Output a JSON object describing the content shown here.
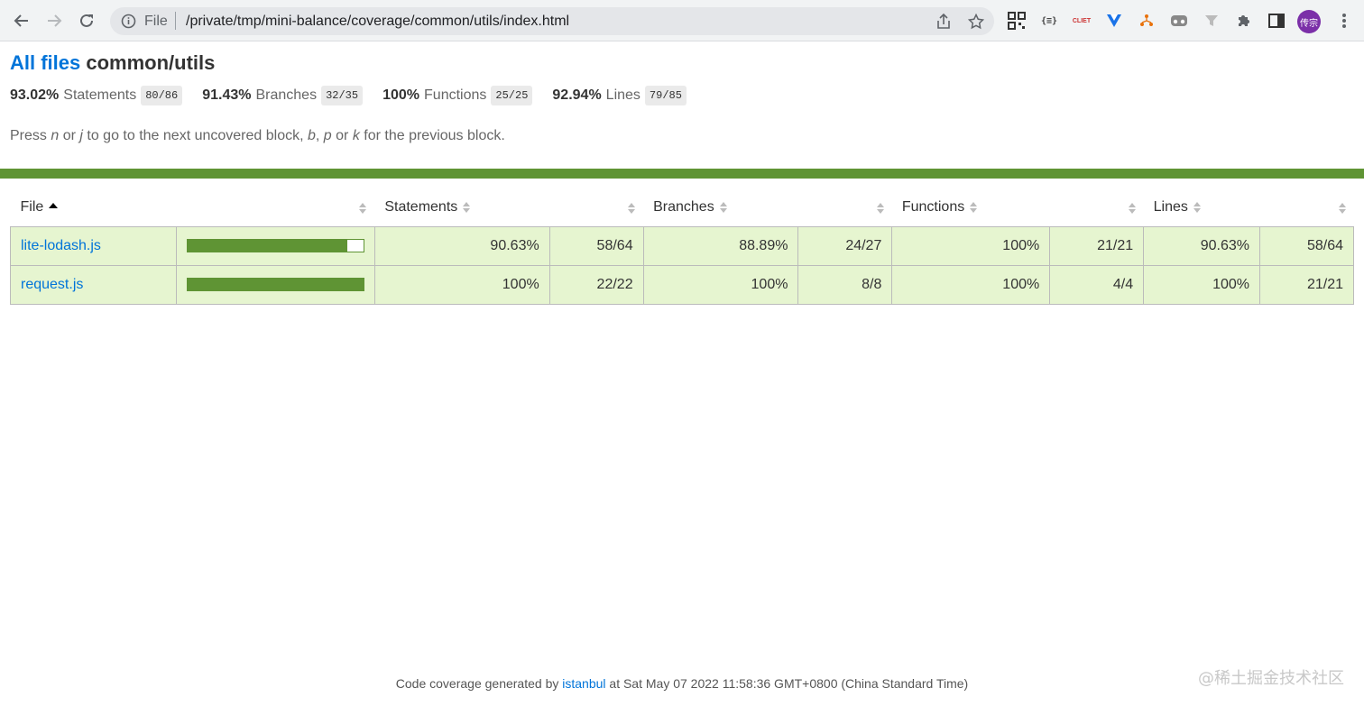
{
  "browser": {
    "scheme_label": "File",
    "url": "/private/tmp/mini-balance/coverage/common/utils/index.html",
    "avatar_text": "传宗",
    "icons": [
      "back-arrow-icon",
      "forward-arrow-icon",
      "reload-icon",
      "info-icon",
      "share-icon",
      "star-icon",
      "qr-code-icon",
      "json-extension-icon",
      "cliet-extension-icon",
      "vue-devtools-icon",
      "network-extension-icon",
      "gamepad-extension-icon",
      "filter-extension-icon",
      "puzzle-piece-icon",
      "side-panel-icon",
      "more-menu-icon"
    ]
  },
  "page": {
    "breadcrumb_link": "All files",
    "title": "common/utils",
    "summary": [
      {
        "pct": "93.02%",
        "label": "Statements",
        "fraction": "80/86"
      },
      {
        "pct": "91.43%",
        "label": "Branches",
        "fraction": "32/35"
      },
      {
        "pct": "100%",
        "label": "Functions",
        "fraction": "25/25"
      },
      {
        "pct": "92.94%",
        "label": "Lines",
        "fraction": "79/85"
      }
    ],
    "hint": {
      "p1": "Press ",
      "k_n": "n",
      "p2": " or ",
      "k_j": "j",
      "p3": " to go to the next uncovered block, ",
      "k_b": "b",
      "p4": ", ",
      "k_p": "p",
      "p5": " or ",
      "k_k": "k",
      "p6": " for the previous block."
    },
    "status_color": "#5f9434"
  },
  "table": {
    "headers": {
      "file": "File",
      "statements": "Statements",
      "branches": "Branches",
      "functions": "Functions",
      "lines": "Lines"
    },
    "rows": [
      {
        "file": "lite-lodash.js",
        "coverage_pct": 90.63,
        "stmt_pct": "90.63%",
        "stmt_frac": "58/64",
        "branch_pct": "88.89%",
        "branch_frac": "24/27",
        "func_pct": "100%",
        "func_frac": "21/21",
        "line_pct": "90.63%",
        "line_frac": "58/64"
      },
      {
        "file": "request.js",
        "coverage_pct": 100,
        "stmt_pct": "100%",
        "stmt_frac": "22/22",
        "branch_pct": "100%",
        "branch_frac": "8/8",
        "func_pct": "100%",
        "func_frac": "4/4",
        "line_pct": "100%",
        "line_frac": "21/21"
      }
    ],
    "high_color": "#e6f5d0"
  },
  "footer": {
    "prefix": "Code coverage generated by ",
    "link": "istanbul",
    "suffix": " at Sat May 07 2022 11:58:36 GMT+0800 (China Standard Time)"
  },
  "watermark": "@稀土掘金技术社区"
}
